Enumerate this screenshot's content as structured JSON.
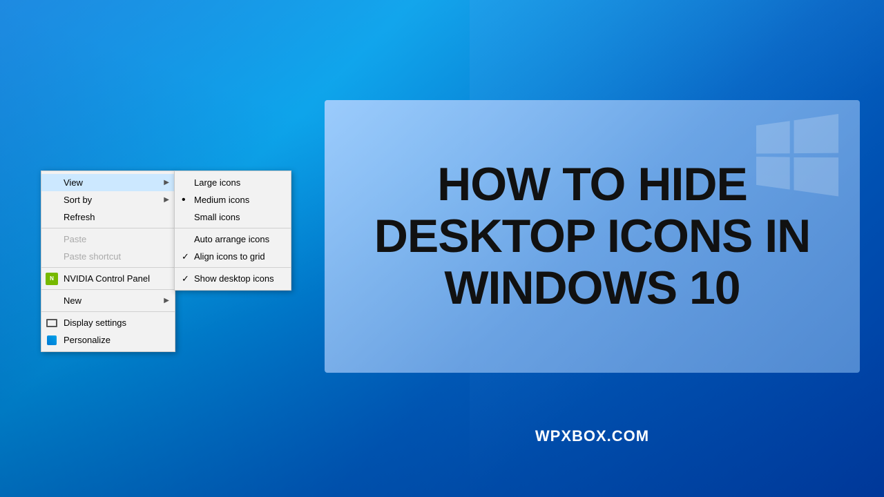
{
  "background": {
    "description": "Windows 10 desktop background - blue gradient"
  },
  "context_menu": {
    "items": [
      {
        "id": "view",
        "label": "View",
        "has_arrow": true,
        "disabled": false
      },
      {
        "id": "sort_by",
        "label": "Sort by",
        "has_arrow": true,
        "disabled": false
      },
      {
        "id": "refresh",
        "label": "Refresh",
        "has_arrow": false,
        "disabled": false
      },
      {
        "id": "separator1",
        "type": "separator"
      },
      {
        "id": "paste",
        "label": "Paste",
        "has_arrow": false,
        "disabled": true
      },
      {
        "id": "paste_shortcut",
        "label": "Paste shortcut",
        "has_arrow": false,
        "disabled": true
      },
      {
        "id": "separator2",
        "type": "separator"
      },
      {
        "id": "nvidia",
        "label": "NVIDIA Control Panel",
        "has_arrow": false,
        "disabled": false,
        "has_icon": true
      },
      {
        "id": "separator3",
        "type": "separator"
      },
      {
        "id": "new",
        "label": "New",
        "has_arrow": true,
        "disabled": false
      },
      {
        "id": "separator4",
        "type": "separator"
      },
      {
        "id": "display_settings",
        "label": "Display settings",
        "has_arrow": false,
        "disabled": false,
        "has_icon": true
      },
      {
        "id": "personalize",
        "label": "Personalize",
        "has_arrow": false,
        "disabled": false,
        "has_icon": true
      }
    ]
  },
  "view_submenu": {
    "items": [
      {
        "id": "large_icons",
        "label": "Large icons",
        "marker": "none"
      },
      {
        "id": "medium_icons",
        "label": "Medium icons",
        "marker": "bullet"
      },
      {
        "id": "small_icons",
        "label": "Small icons",
        "marker": "none"
      },
      {
        "id": "separator1",
        "type": "separator"
      },
      {
        "id": "auto_arrange",
        "label": "Auto arrange icons",
        "marker": "none"
      },
      {
        "id": "align_to_grid",
        "label": "Align icons to grid",
        "marker": "check"
      },
      {
        "id": "separator2",
        "type": "separator"
      },
      {
        "id": "show_desktop",
        "label": "Show desktop icons",
        "marker": "check"
      }
    ]
  },
  "thumbnail": {
    "title_line1": "HOW TO HIDE",
    "title_line2": "DESKTOP ICONS IN",
    "title_line3": "WINDOWS 10",
    "website": "WPXBOX.COM"
  }
}
